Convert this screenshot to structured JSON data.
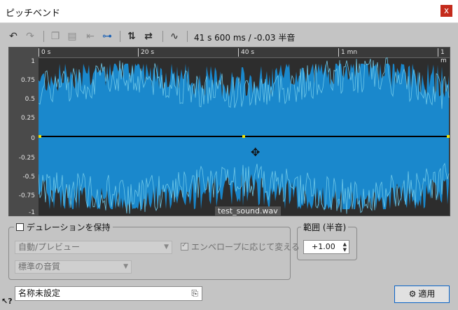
{
  "window": {
    "title": "ピッチベンド",
    "close_icon": "close-icon",
    "close_glyph": "x"
  },
  "toolbar": {
    "icons": [
      "undo-icon",
      "redo-icon",
      "copy-icon",
      "paste-icon",
      "go-start-icon",
      "link-icon",
      "swap-vertical-icon",
      "swap-horizontal-icon",
      "curve-icon"
    ],
    "readout": "41 s 600 ms / -0.03 半音"
  },
  "waveform": {
    "y_labels": [
      "1",
      "0.75",
      "0.5",
      "0.25",
      "0",
      "-0.25",
      "-0.5",
      "-0.75",
      "-1"
    ],
    "ruler_labels": [
      "0 s",
      "20 s",
      "40 s",
      "1 mn",
      "1 m"
    ],
    "file_name": "test_sound.wav",
    "colors": {
      "background": "#2d2d2d",
      "wave_fill": "#1a88cc",
      "wave_light": "#6fc8e8",
      "envelope": "#000000",
      "handle": "#f2e200"
    }
  },
  "duration_group": {
    "checkbox_label": "デュレーションを保持",
    "checked": false,
    "mode_select": "自動/プレビュー",
    "envelope_checkbox_label": "エンベロープに応じて変える",
    "quality_select": "標準の音質"
  },
  "range_group": {
    "legend": "範囲 (半音)",
    "value": "+1.00"
  },
  "footer": {
    "preset_name": "名称未設定",
    "apply_label": "適用",
    "apply_icon": "gears-icon",
    "help_icon": "help-cursor-icon"
  }
}
